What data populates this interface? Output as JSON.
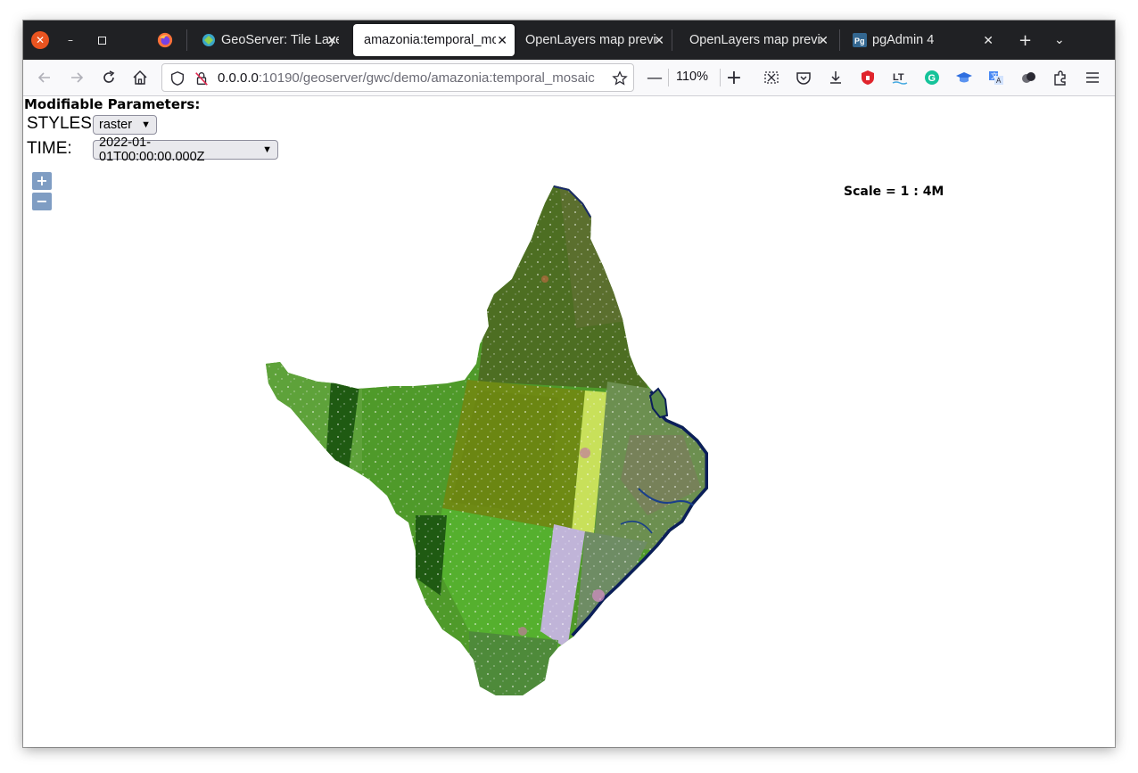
{
  "browser": {
    "tabs": [
      {
        "label": "GeoServer: Tile Layers",
        "active": false
      },
      {
        "label": "amazonia:temporal_mosaic",
        "active": true
      },
      {
        "label": "OpenLayers map preview",
        "active": false
      },
      {
        "label": "OpenLayers map preview",
        "active": false
      },
      {
        "label": "pgAdmin 4",
        "active": false
      }
    ],
    "url_host": "0.0.0.0",
    "url_rest": ":10190/geoserver/gwc/demo/amazonia:temporal_mosaic",
    "zoom": "110%"
  },
  "page": {
    "params_title": "Modifiable Parameters:",
    "styles_label": "STYLES:",
    "styles_value": "raster",
    "time_label": "TIME:",
    "time_value": "2022-01-01T00:00:00.000Z",
    "zoom_in": "+",
    "zoom_out": "−",
    "scale": "Scale = 1 : 4M"
  },
  "colors": {
    "tabstrip_bg": "#202124",
    "close_button": "#e95420",
    "map_green": "#4f9a2a",
    "map_dark_green": "#2d6e18",
    "map_olive": "#6e8a14",
    "map_coast": "#0b1e5a"
  }
}
